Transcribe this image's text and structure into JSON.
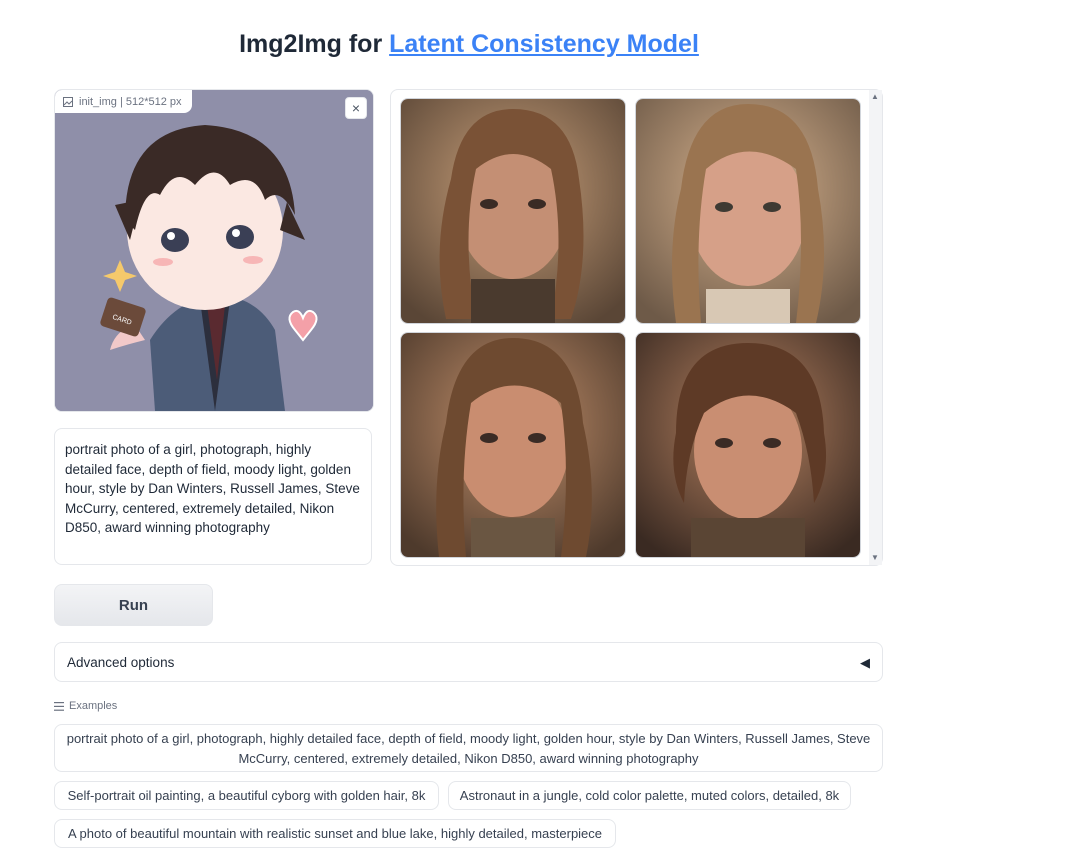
{
  "header": {
    "title_prefix": "Img2Img for ",
    "title_link": "Latent Consistency Model"
  },
  "init_image": {
    "label": "init_img | 512*512 px",
    "close_symbol": "×",
    "icon": "image-icon"
  },
  "prompt": {
    "value": "portrait photo of a girl, photograph, highly detailed face, depth of field, moody light, golden hour, style by Dan Winters, Russell James, Steve McCurry, centered, extremely detailed, Nikon D850, award winning photography"
  },
  "run_button": {
    "label": "Run"
  },
  "advanced": {
    "label": "Advanced options",
    "caret": "◀"
  },
  "examples": {
    "label": "Examples",
    "items": [
      "portrait photo of a girl, photograph, highly detailed face, depth of field, moody light, golden hour, style by Dan Winters, Russell James, Steve McCurry, centered, extremely detailed, Nikon D850, award winning photography",
      "Self-portrait oil painting, a beautiful cyborg with golden hair, 8k",
      "Astronaut in a jungle, cold color palette, muted colors, detailed, 8k",
      "A photo of beautiful mountain with realistic sunset and blue lake, highly detailed, masterpiece"
    ]
  },
  "colors": {
    "accent": "#3b82f6",
    "border": "#e5e7eb"
  }
}
